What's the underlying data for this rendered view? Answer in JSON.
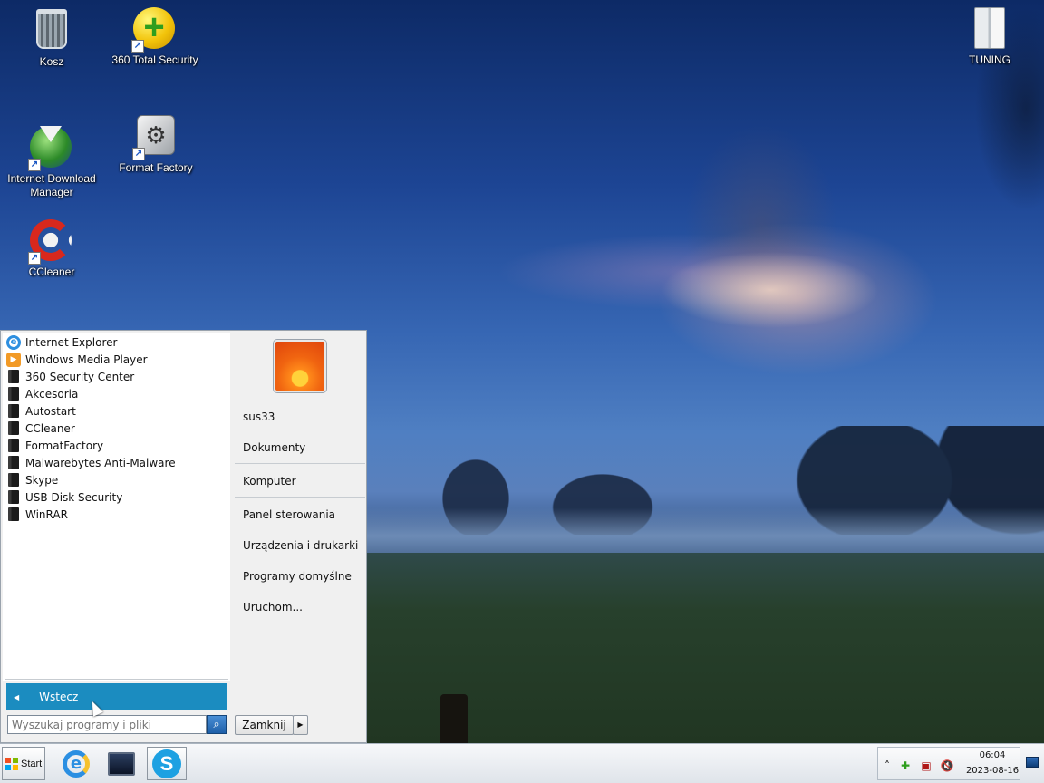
{
  "desktop": {
    "icons": [
      {
        "label": "Kosz",
        "icon": "recycle-bin-icon"
      },
      {
        "label": "360 Total Security",
        "icon": "360-total-security-icon"
      },
      {
        "label": "TUNING",
        "icon": "folder-icon"
      },
      {
        "label": "Internet Download Manager",
        "icon": "idm-icon"
      },
      {
        "label": "Format Factory",
        "icon": "format-factory-icon"
      },
      {
        "label": "CCleaner",
        "icon": "ccleaner-icon"
      }
    ]
  },
  "start_menu": {
    "programs": [
      {
        "label": "Internet Explorer",
        "icon": "internet-explorer-icon"
      },
      {
        "label": "Windows Media Player",
        "icon": "windows-media-player-icon"
      },
      {
        "label": "360 Security Center",
        "icon": "folder-icon"
      },
      {
        "label": "Akcesoria",
        "icon": "folder-icon"
      },
      {
        "label": "Autostart",
        "icon": "folder-icon"
      },
      {
        "label": "CCleaner",
        "icon": "folder-icon"
      },
      {
        "label": "FormatFactory",
        "icon": "folder-icon"
      },
      {
        "label": "Malwarebytes Anti-Malware",
        "icon": "folder-icon"
      },
      {
        "label": "Skype",
        "icon": "folder-icon"
      },
      {
        "label": "USB Disk Security",
        "icon": "folder-icon"
      },
      {
        "label": "WinRAR",
        "icon": "folder-icon"
      }
    ],
    "back_label": "Wstecz",
    "search_placeholder": "Wyszukaj programy i pliki",
    "right_items": {
      "user": "sus33",
      "documents": "Dokumenty",
      "computer": "Komputer",
      "control_panel": "Panel sterowania",
      "devices_printers": "Urządzenia i drukarki",
      "default_programs": "Programy domyślne",
      "run": "Uruchom..."
    },
    "shutdown_label": "Zamknij"
  },
  "taskbar": {
    "start_label": "Start",
    "pinned": [
      {
        "name": "Internet Explorer",
        "icon": "internet-explorer-icon"
      },
      {
        "name": "Komputer",
        "icon": "computer-icon"
      },
      {
        "name": "Skype",
        "icon": "skype-icon"
      }
    ],
    "clock_time": "06:04",
    "clock_date": "2023-08-16"
  },
  "colors": {
    "accent": "#1b8cc0",
    "start_menu_bg": "#f0f0f0"
  }
}
